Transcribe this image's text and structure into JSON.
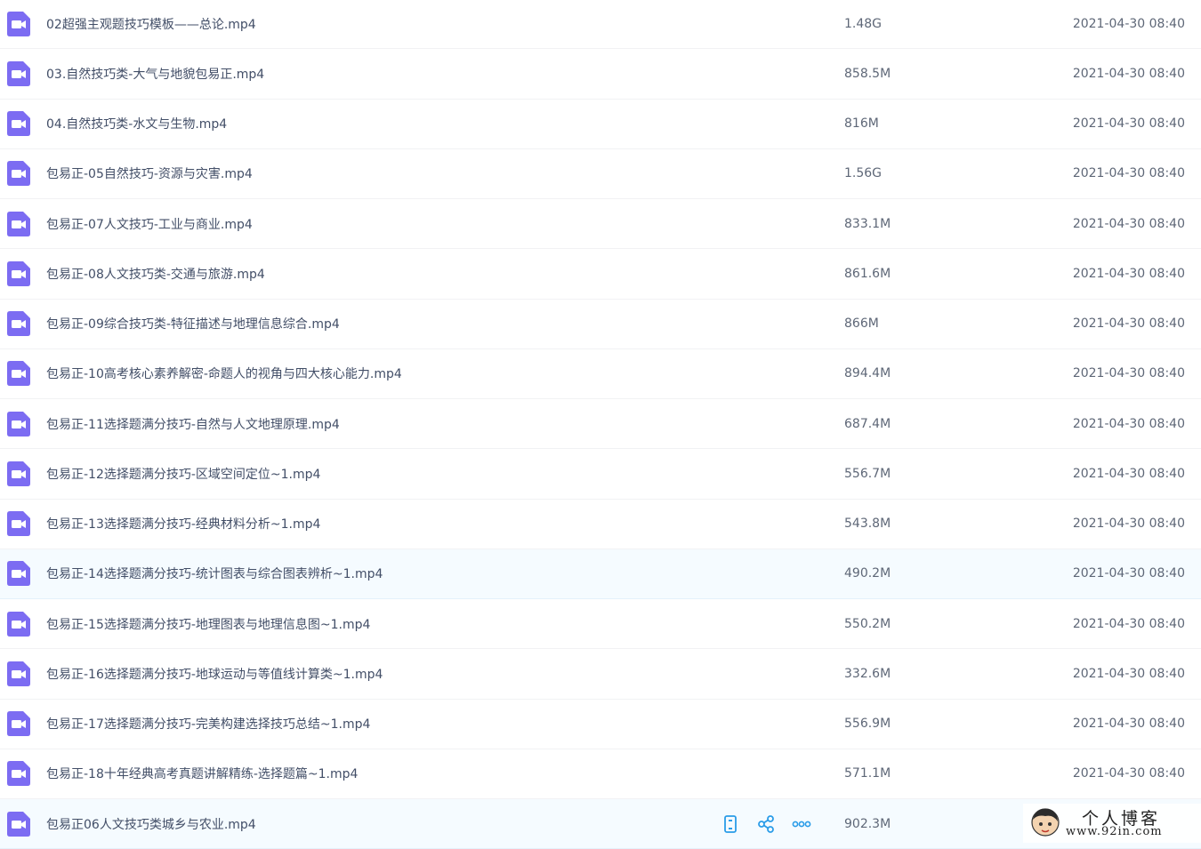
{
  "files": [
    {
      "name": "02超强主观题技巧模板——总论.mp4",
      "size": "1.48G",
      "time": "2021-04-30 08:40"
    },
    {
      "name": "03.自然技巧类-大气与地貌包易正.mp4",
      "size": "858.5M",
      "time": "2021-04-30 08:40"
    },
    {
      "name": "04.自然技巧类-水文与生物.mp4",
      "size": "816M",
      "time": "2021-04-30 08:40"
    },
    {
      "name": "包易正-05自然技巧-资源与灾害.mp4",
      "size": "1.56G",
      "time": "2021-04-30 08:40"
    },
    {
      "name": "包易正-07人文技巧-工业与商业.mp4",
      "size": "833.1M",
      "time": "2021-04-30 08:40"
    },
    {
      "name": "包易正-08人文技巧类-交通与旅游.mp4",
      "size": "861.6M",
      "time": "2021-04-30 08:40"
    },
    {
      "name": "包易正-09综合技巧类-特征描述与地理信息综合.mp4",
      "size": "866M",
      "time": "2021-04-30 08:40"
    },
    {
      "name": "包易正-10高考核心素养解密-命题人的视角与四大核心能力.mp4",
      "size": "894.4M",
      "time": "2021-04-30 08:40"
    },
    {
      "name": "包易正-11选择题满分技巧-自然与人文地理原理.mp4",
      "size": "687.4M",
      "time": "2021-04-30 08:40"
    },
    {
      "name": "包易正-12选择题满分技巧-区域空间定位~1.mp4",
      "size": "556.7M",
      "time": "2021-04-30 08:40"
    },
    {
      "name": "包易正-13选择题满分技巧-经典材料分析~1.mp4",
      "size": "543.8M",
      "time": "2021-04-30 08:40"
    },
    {
      "name": "包易正-14选择题满分技巧-统计图表与综合图表辨析~1.mp4",
      "size": "490.2M",
      "time": "2021-04-30 08:40"
    },
    {
      "name": "包易正-15选择题满分技巧-地理图表与地理信息图~1.mp4",
      "size": "550.2M",
      "time": "2021-04-30 08:40"
    },
    {
      "name": "包易正-16选择题满分技巧-地球运动与等值线计算类~1.mp4",
      "size": "332.6M",
      "time": "2021-04-30 08:40"
    },
    {
      "name": "包易正-17选择题满分技巧-完美构建选择技巧总结~1.mp4",
      "size": "556.9M",
      "time": "2021-04-30 08:40"
    },
    {
      "name": "包易正-18十年经典高考真题讲解精练-选择题篇~1.mp4",
      "size": "571.1M",
      "time": "2021-04-30 08:40"
    },
    {
      "name": "包易正06人文技巧类城乡与农业.mp4",
      "size": "902.3M",
      "time": ""
    }
  ],
  "hovered_index": 11,
  "action_row_index": 16,
  "row_actions": [
    "phone-icon",
    "share-icon",
    "more-icon"
  ],
  "file_icon": "video-file-icon",
  "colors": {
    "icon": "#7c6cf2",
    "action": "#2a9ce8",
    "hover_bg": "#f5fbff",
    "text": "#424e67"
  },
  "watermark": {
    "title": "个人博客",
    "url": "www.92in.com"
  }
}
